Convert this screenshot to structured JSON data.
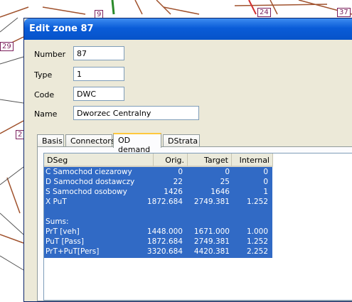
{
  "map": {
    "labels": [
      "9",
      "29",
      "24",
      "37",
      "2"
    ]
  },
  "dialog": {
    "title": "Edit zone 87",
    "fields": [
      {
        "label": "Number",
        "value": "87"
      },
      {
        "label": "Type",
        "value": "1"
      },
      {
        "label": "Code",
        "value": "DWC"
      },
      {
        "label": "Name",
        "value": "Dworzec Centralny"
      }
    ],
    "tabs": [
      "Basis",
      "Connectors",
      "OD demand",
      "DStrata"
    ],
    "active_tab": "OD demand",
    "grid": {
      "columns": [
        "DSeg",
        "Orig.",
        "Target",
        "Internal"
      ],
      "rows": [
        [
          "C Samochod ciezarowy",
          "0",
          "0",
          "0"
        ],
        [
          "D Samochod dostawczy",
          "22",
          "25",
          "0"
        ],
        [
          "S Samochod osobowy",
          "1426",
          "1646",
          "1"
        ],
        [
          "X PuT",
          "1872.684",
          "2749.381",
          "1.252"
        ],
        [
          "",
          "",
          "",
          ""
        ],
        [
          "Sums:",
          "",
          "",
          ""
        ],
        [
          "PrT [veh]",
          "1448.000",
          "1671.000",
          "1.000"
        ],
        [
          "PuT [Pass]",
          "1872.684",
          "2749.381",
          "1.252"
        ],
        [
          "PrT+PuT[Pers]",
          "3320.684",
          "4420.381",
          "2.252"
        ]
      ]
    }
  },
  "colors": {
    "title_bar": "#0a5cd8",
    "selection": "#316ac5",
    "dialog_face": "#ece9d8",
    "map_line": "#a0522d"
  }
}
